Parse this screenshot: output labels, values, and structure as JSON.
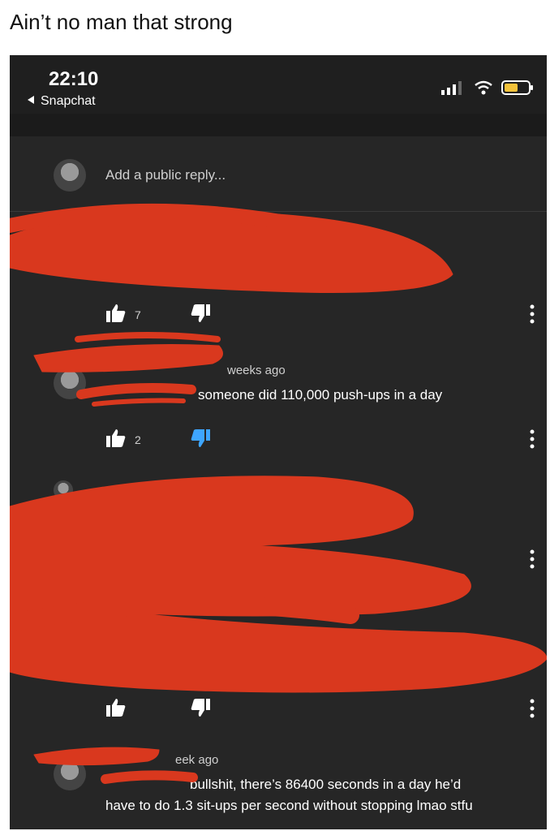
{
  "caption": "Ain’t no man that strong",
  "statusbar": {
    "time": "22:10",
    "back_label": "Snapchat"
  },
  "reply_box": {
    "placeholder": "Add a public reply..."
  },
  "comments": [
    {
      "likes": "7"
    },
    {
      "meta": "weeks ago",
      "text": "someone did 110,000 push-ups in a day",
      "likes": "2"
    },
    {
      "likes": ""
    },
    {
      "meta": "eek ago",
      "text_line1": "bullshit, there’s 86400 seconds in a day he’d",
      "text_line2": "have to do 1.3 sit-ups per second without stopping lmao stfu"
    }
  ],
  "colors": {
    "background": "#262626",
    "scribble": "#d9381e",
    "dislike_active": "#3ea6ff"
  }
}
